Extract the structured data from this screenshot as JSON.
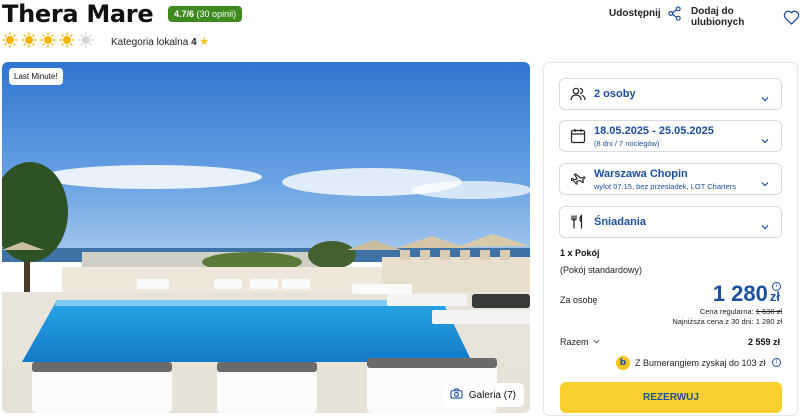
{
  "hotel": {
    "name": "Thera Mare",
    "rating_score": "4.7/6",
    "rating_count": "(30 opinii)",
    "sun_count": 4,
    "sun_total": 5,
    "category_label": "Kategoria lokalna",
    "category_value": "4",
    "category_star": "★"
  },
  "header_actions": {
    "share_label": "Udostępnij",
    "share_icon": "share-icon",
    "favorite_label": "Dodaj do ulubionych",
    "favorite_icon": "heart-icon"
  },
  "gallery": {
    "badge": "Last Minute!",
    "button_label": "Galeria (7)",
    "button_icon": "camera-icon"
  },
  "booking": {
    "guests": {
      "label": "2 osoby",
      "icon": "people-icon"
    },
    "dates": {
      "label": "18.05.2025 - 25.05.2025",
      "sub": "(8 dni / 7 noclegów)",
      "icon": "calendar-icon"
    },
    "departure": {
      "label": "Warszawa Chopin",
      "sub": "wylot 07:15, bez przesiadek, LOT Charters",
      "icon": "plane-icon"
    },
    "board": {
      "label": "Śniadania",
      "icon": "cutlery-icon"
    },
    "room_title": "1 x Pokój",
    "room_type": "(Pokój standardowy)",
    "per_person_label": "Za osobę",
    "price": "1 280",
    "currency": "zł",
    "regular_label": "Cena regularna:",
    "regular_price": "1 630 zł",
    "lowest_text": "Najniższa cena z 30 dni: 1 280 zł",
    "total_label": "Razem",
    "total_value": "2 559 zł",
    "bumerang_text": "Z Bumerangiem zyskaj do 103 zł",
    "reserve_label": "REZERWUJ"
  },
  "colors": {
    "accent_blue": "#1c4fa0",
    "rating_green": "#3f8a1f",
    "reserve_yellow": "#f9cf2d",
    "sun_yellow": "#f7b500"
  }
}
